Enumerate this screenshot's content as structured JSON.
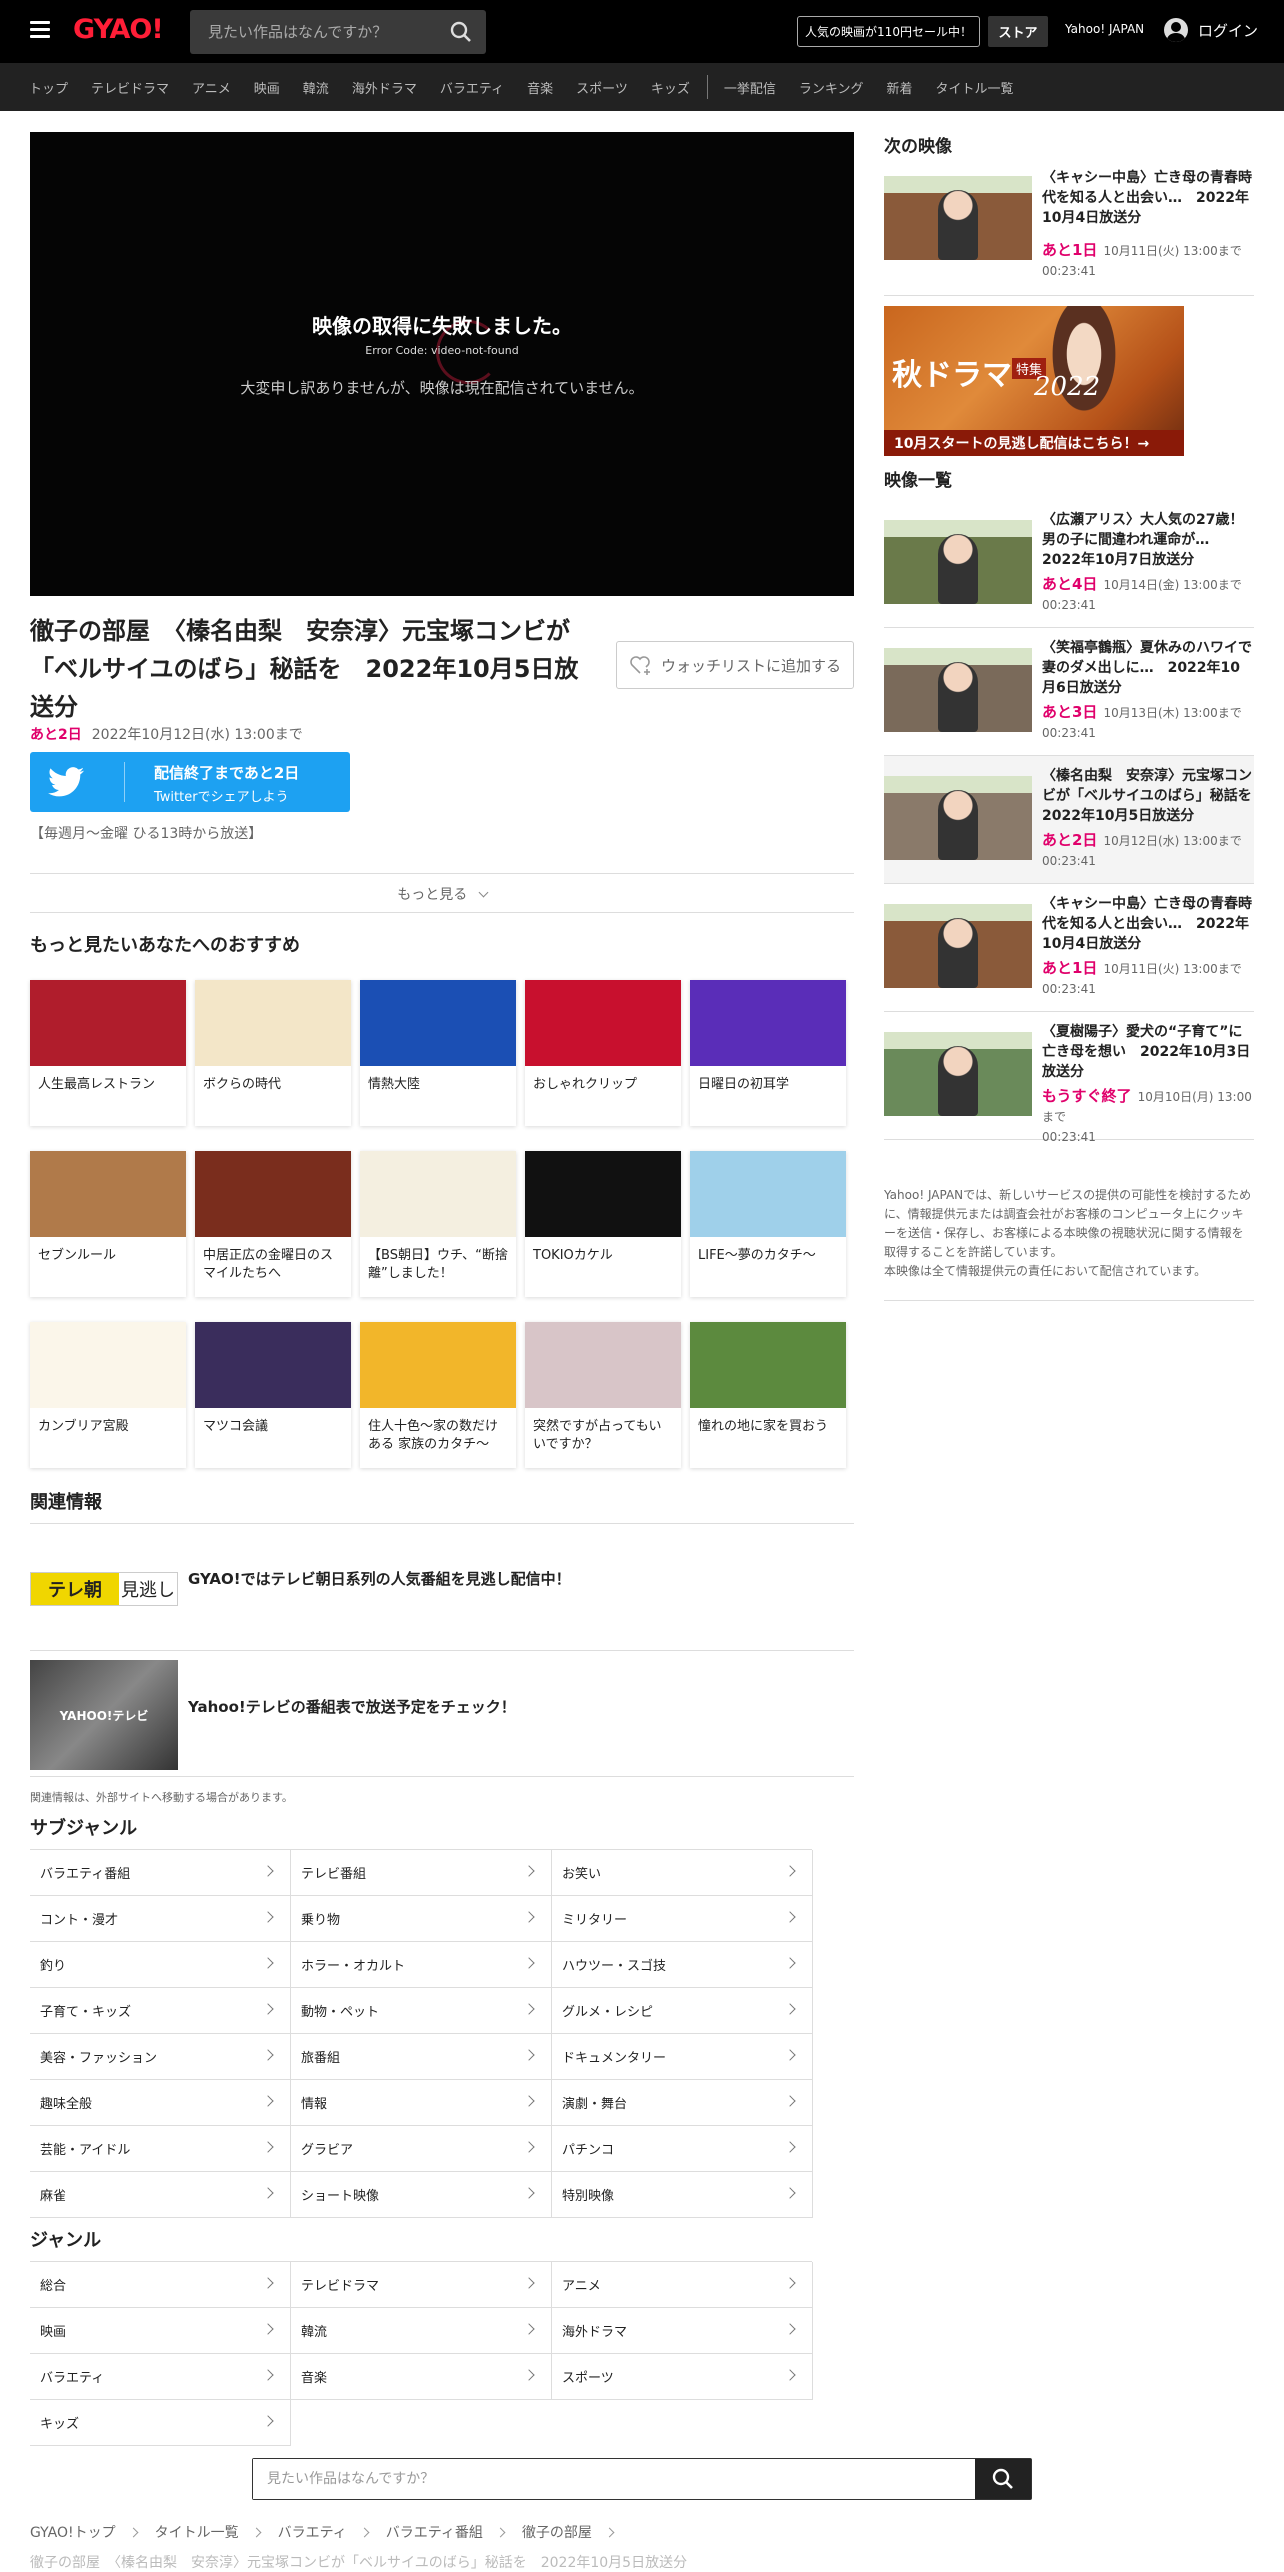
{
  "header": {
    "logo": "GYAO!",
    "search_placeholder": "見たい作品はなんですか？",
    "sale_label": "人気の映画が110円セール中！",
    "store_label": "ストア",
    "yahoo_label": "Yahoo! JAPAN",
    "login_label": "ログイン"
  },
  "nav": {
    "items": [
      "トップ",
      "テレビドラマ",
      "アニメ",
      "映画",
      "韓流",
      "海外ドラマ",
      "バラエティ",
      "音楽",
      "スポーツ",
      "キッズ"
    ],
    "items2": [
      "一挙配信",
      "ランキング",
      "新着",
      "タイトル一覧"
    ]
  },
  "player": {
    "error_title": "映像の取得に失敗しました。",
    "error_code": "Error Code: video-not-found",
    "error_message": "大変申し訳ありませんが、映像は現在配信されていません。"
  },
  "program": {
    "title": "徹子の部屋　〈榛名由梨　安奈淳〉元宝塚コンビが「ベルサイユのばら」秘話を　2022年10月5日放送分",
    "watchlist_label": "ウォッチリストに追加する",
    "remaining": "あと2日",
    "until": "2022年10月12日(水) 13:00まで",
    "twitter_line1": "配信終了まであと2日",
    "twitter_line2": "Twitterでシェアしよう",
    "schedule": "【毎週月～金曜 ひる13時から放送】",
    "more_label": "もっと見る"
  },
  "recommend": {
    "heading": "もっと見たいあなたへのおすすめ",
    "items": [
      {
        "label": "人生最高レストラン",
        "color": "#b01d2c"
      },
      {
        "label": "ボクらの時代",
        "color": "#f3e6c8"
      },
      {
        "label": "情熱大陸",
        "color": "#1b4fb4"
      },
      {
        "label": "おしゃれクリップ",
        "color": "#c8102e"
      },
      {
        "label": "日曜日の初耳学",
        "color": "#5a2db8"
      },
      {
        "label": "セブンルール",
        "color": "#b07a4a"
      },
      {
        "label": "中居正広の金曜日のスマイルたちへ",
        "color": "#7a2d1d"
      },
      {
        "label": "【BS朝日】ウチ、“断捨離”しました！",
        "color": "#f4efe0"
      },
      {
        "label": "TOKIOカケル",
        "color": "#111111"
      },
      {
        "label": "LIFE～夢のカタチ～",
        "color": "#9fd0ea"
      },
      {
        "label": "カンブリア宮殿",
        "color": "#fbf6ea"
      },
      {
        "label": "マツコ会議",
        "color": "#3a2d5c"
      },
      {
        "label": "住人十色～家の数だけある 家族のカタチ～",
        "color": "#f2b62a"
      },
      {
        "label": "突然ですが占ってもいいですか？",
        "color": "#d8c5c8"
      },
      {
        "label": "憧れの地に家を買おう",
        "color": "#5c8a3e"
      }
    ]
  },
  "related": {
    "heading": "関連情報",
    "items": [
      {
        "logo": "テレ朝",
        "logo2": "見逃し",
        "text": "GYAO!ではテレビ朝日系列の人気番組を見逃し配信中！"
      },
      {
        "logo": "YAHOO!テレビ",
        "text": "Yahoo!テレビの番組表で放送予定をチェック！"
      }
    ],
    "note": "関連情報は、外部サイトへ移動する場合があります。"
  },
  "subgenre": {
    "heading": "サブジャンル",
    "items": [
      "バラエティ番組",
      "テレビ番組",
      "お笑い",
      "コント・漫才",
      "乗り物",
      "ミリタリー",
      "釣り",
      "ホラー・オカルト",
      "ハウツー・スゴ技",
      "子育て・キッズ",
      "動物・ペット",
      "グルメ・レシピ",
      "美容・ファッション",
      "旅番組",
      "ドキュメンタリー",
      "趣味全般",
      "情報",
      "演劇・舞台",
      "芸能・アイドル",
      "グラビア",
      "パチンコ",
      "麻雀",
      "ショート映像",
      "特別映像"
    ]
  },
  "genre": {
    "heading": "ジャンル",
    "items": [
      "総合",
      "テレビドラマ",
      "アニメ",
      "映画",
      "韓流",
      "海外ドラマ",
      "バラエティ",
      "音楽",
      "スポーツ",
      "キッズ"
    ]
  },
  "footer": {
    "search_placeholder": "見たい作品はなんですか？",
    "breadcrumb": [
      "GYAO!トップ",
      "タイトル一覧",
      "バラエティ",
      "バラエティ番組",
      "徹子の部屋"
    ],
    "current": "徹子の部屋　〈榛名由梨　安奈淳〉元宝塚コンビが「ベルサイユのばら」秘話を　2022年10月5日放送分"
  },
  "sidebar": {
    "next_heading": "次の映像",
    "next": {
      "title": "〈キャシー中島〉亡き母の青春時代を知る人と出会い…　2022年10月4日放送分",
      "remain": "あと1日",
      "until": "10月11日(火) 13:00まで",
      "duration": "00:23:41",
      "color": "#8a5a3a"
    },
    "banner_line1": "秋ドラマ",
    "banner_tag": "特集",
    "banner_year": "2022",
    "banner_line2": "10月スタートの見逃し配信はこちら！→",
    "list_heading": "映像一覧",
    "list": [
      {
        "title": "〈広瀬アリス〉大人気の27歳！男の子に間違われ運命が…　2022年10月7日放送分",
        "remain": "あと4日",
        "until": "10月14日(金) 13:00まで",
        "duration": "00:23:41",
        "color": "#6a7a4a",
        "hl": false
      },
      {
        "title": "〈笑福亭鶴瓶〉夏休みのハワイで妻のダメ出しに…　2022年10月6日放送分",
        "remain": "あと3日",
        "until": "10月13日(木) 13:00まで",
        "duration": "00:23:41",
        "color": "#7a6a5a",
        "hl": false
      },
      {
        "title": "〈榛名由梨　安奈淳〉元宝塚コンビが「ベルサイユのばら」秘話を　2022年10月5日放送分",
        "remain": "あと2日",
        "until": "10月12日(水) 13:00まで",
        "duration": "00:23:41",
        "color": "#8a7a6a",
        "hl": true
      },
      {
        "title": "〈キャシー中島〉亡き母の青春時代を知る人と出会い…　2022年10月4日放送分",
        "remain": "あと1日",
        "until": "10月11日(火) 13:00まで",
        "duration": "00:23:41",
        "color": "#8a5a3a",
        "hl": false
      },
      {
        "title": "〈夏樹陽子〉愛犬の“子育て”に亡き母を想い　2022年10月3日放送分",
        "remain": "もうすぐ終了",
        "until": "10月10日(月) 13:00まで",
        "duration": "00:23:41",
        "color": "#6a8a5a",
        "hl": false
      }
    ],
    "disclaimer": "Yahoo! JAPANでは、新しいサービスの提供の可能性を検討するために、情報提供元または調査会社がお客様のコンピュータ上にクッキーを送信・保存し、お客様による本映像の視聴状況に関する情報を取得することを許諾しています。",
    "disclaimer2": "本映像は全て情報提供元の責任において配信されています。"
  }
}
